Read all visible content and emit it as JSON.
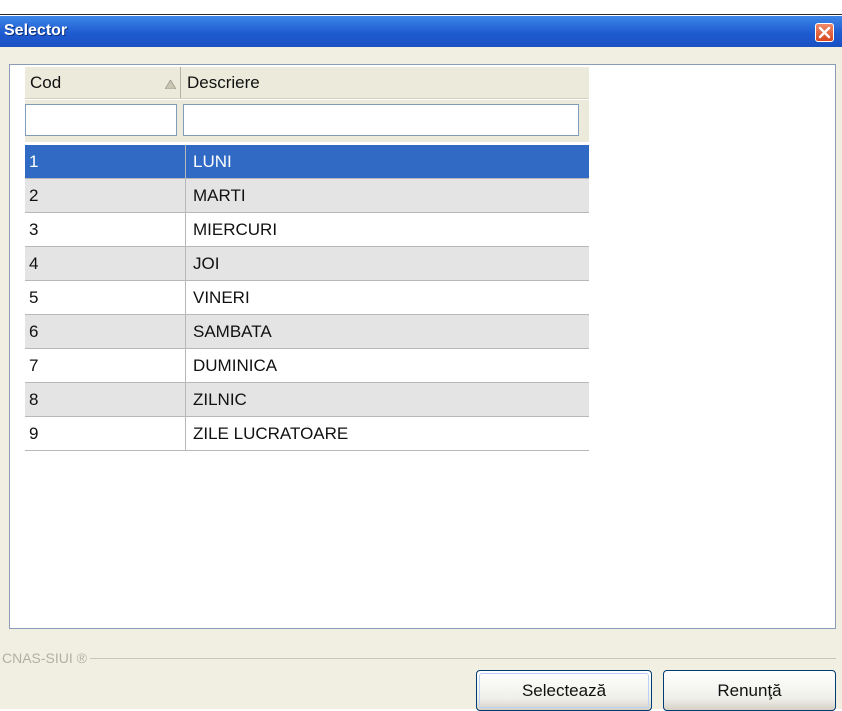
{
  "window": {
    "title": "Selector"
  },
  "table": {
    "columns": [
      "Cod",
      "Descriere"
    ],
    "filter_values": [
      "",
      ""
    ],
    "rows": [
      {
        "cod": "1",
        "descriere": "LUNI",
        "selected": true
      },
      {
        "cod": "2",
        "descriere": "MARTI"
      },
      {
        "cod": "3",
        "descriere": "MIERCURI"
      },
      {
        "cod": "4",
        "descriere": "JOI"
      },
      {
        "cod": "5",
        "descriere": "VINERI"
      },
      {
        "cod": "6",
        "descriere": "SAMBATA"
      },
      {
        "cod": "7",
        "descriere": "DUMINICA"
      },
      {
        "cod": "8",
        "descriere": "ZILNIC"
      },
      {
        "cod": "9",
        "descriere": "ZILE LUCRATOARE"
      }
    ],
    "sort_icon": "sort-ascending-icon"
  },
  "footer": {
    "watermark": "CNAS-SIUI ®"
  },
  "buttons": {
    "select": "Selectează",
    "cancel": "Renunţă"
  },
  "colors": {
    "titlebar": "#1e5bd1",
    "selected_row": "#316ac5",
    "alt_row": "#e4e4e4",
    "window_bg": "#f1efe2"
  }
}
